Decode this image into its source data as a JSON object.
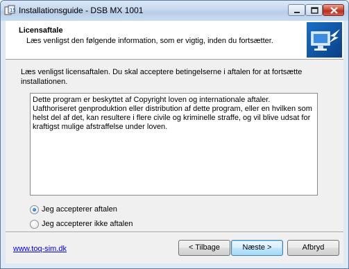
{
  "window": {
    "title": "Installationsguide - DSB MX 1001"
  },
  "header": {
    "title": "Licensaftale",
    "subtitle": "Læs venligst den følgende information, som er vigtig, inden du fortsætter."
  },
  "main": {
    "intro": "Læs venligst licensaftalen. Du skal acceptere betingelserne i aftalen for at fortsætte installationen.",
    "license_text": "Dette program er beskyttet af Copyright loven og internationale aftaler.\nUafthoriseret genproduktion eller distribution af dette program, eller en hvilken som helst del af det, kan resultere i flere civile og kriminelle straffe, og vil blive udsat for kraftigst mulige afstraffelse under loven.",
    "accept_label": "Jeg accepterer aftalen",
    "decline_label": "Jeg accepterer ikke aftalen",
    "selected": "accept"
  },
  "footer": {
    "link": "www.toq-sim.dk",
    "back_label": "< Tilbage",
    "next_label": "Næste >",
    "cancel_label": "Afbryd"
  },
  "colors": {
    "link": "#0000ee",
    "header_bg": "#ffffff",
    "dialog_bg": "#f0f0f0",
    "title_close": "#c8422e"
  },
  "icons": [
    "setup-app-icon",
    "minimize-icon",
    "maximize-icon",
    "close-icon",
    "install-wizard-logo-icon"
  ]
}
